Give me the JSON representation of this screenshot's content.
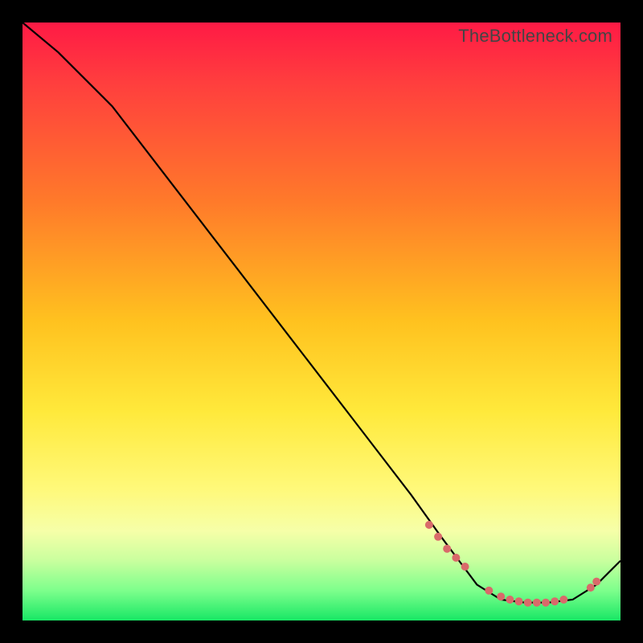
{
  "watermark": "TheBottleneck.com",
  "chart_data": {
    "type": "line",
    "title": "",
    "xlabel": "",
    "ylabel": "",
    "xlim": [
      0,
      100
    ],
    "ylim": [
      0,
      100
    ],
    "grid": false,
    "series": [
      {
        "name": "curve",
        "x": [
          0,
          6,
          15,
          25,
          35,
          45,
          55,
          65,
          70,
          73,
          76,
          80,
          84,
          88,
          92,
          96,
          100
        ],
        "y": [
          100,
          95,
          86,
          73,
          60,
          47,
          34,
          21,
          14,
          10,
          6,
          3.5,
          3,
          3,
          3.5,
          6,
          10
        ]
      }
    ],
    "markers": {
      "name": "highlight-points",
      "x": [
        68,
        69.5,
        71,
        72.5,
        74,
        78,
        80,
        81.5,
        83,
        84.5,
        86,
        87.5,
        89,
        90.5,
        95,
        96
      ],
      "y": [
        16,
        14,
        12,
        10.5,
        9,
        5,
        4,
        3.5,
        3.2,
        3,
        3,
        3,
        3.2,
        3.5,
        5.5,
        6.5
      ],
      "color": "#d96a6a",
      "size": 5
    }
  }
}
